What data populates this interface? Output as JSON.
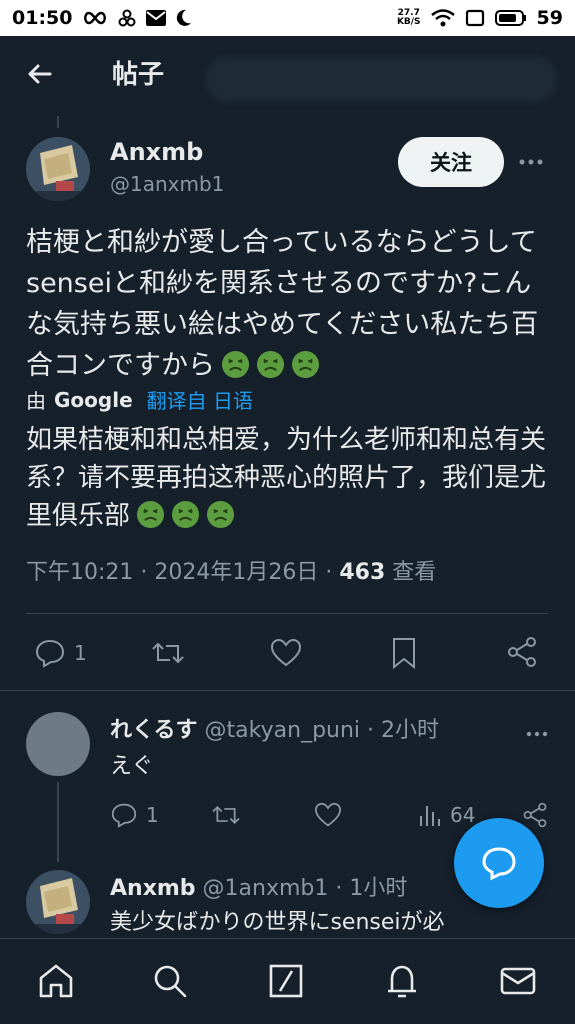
{
  "status_bar": {
    "time": "01:50",
    "net_speed_top": "27.7",
    "net_speed_unit": "KB/S",
    "battery": "59"
  },
  "header": {
    "title": "帖子"
  },
  "tweet": {
    "author_name": "Anxmb",
    "author_handle": "@1anxmb1",
    "follow_label": "关注",
    "text": "桔梗と和紗が愛し合っているならどうしてsenseiと和紗を関系させるのですか?こんな気持ち悪い絵はやめてください私たち百合コンですから",
    "translate_by": "由",
    "translate_provider": "Google",
    "translate_from": "翻译自 日语",
    "translated_text": "如果桔梗和和总相爱，为什么老师和和总有关系？请不要再拍这种恶心的照片了，我们是尤里俱乐部",
    "timestamp": "下午10:21 · 2024年1月26日 · ",
    "views_count": "463",
    "views_label": " 查看",
    "reply_count": "1"
  },
  "replies": [
    {
      "name": "れくるす",
      "meta": " @takyan_puni · 2小时",
      "text": "えぐ",
      "reply_count": "1",
      "views_count": "64"
    },
    {
      "name": "Anxmb",
      "meta": " @1anxmb1 · 1小时",
      "text": "美少女ばかりの世界にsenseiが必"
    }
  ],
  "colors": {
    "background": "#15202b",
    "accent": "#1d9bf0",
    "muted": "#8b98a5",
    "emoji_green": "#5c9e3f"
  },
  "icons": [
    "back-arrow-icon",
    "more-icon",
    "reply-icon",
    "retweet-icon",
    "like-icon",
    "bookmark-icon",
    "share-icon",
    "views-icon",
    "compose-reply-icon",
    "home-icon",
    "search-icon",
    "compose-icon",
    "notifications-icon",
    "messages-icon",
    "nauseated-face-emoji"
  ]
}
